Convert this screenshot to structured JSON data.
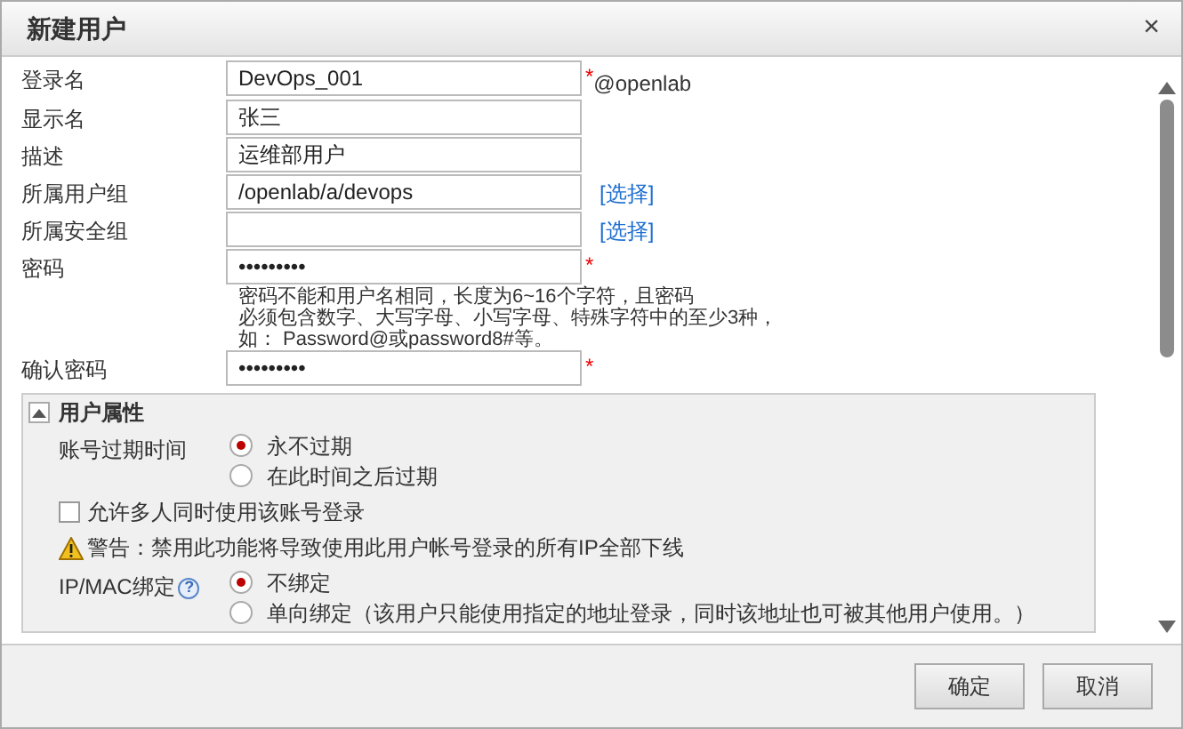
{
  "dialog": {
    "title": "新建用户",
    "close": "×"
  },
  "fields": [
    {
      "label": "登录名",
      "value": "DevOps_001",
      "marker": "*",
      "suffix": "@openlab"
    },
    {
      "label": "显示名",
      "value": "张三"
    },
    {
      "label": "描述",
      "value": "运维部用户"
    },
    {
      "label": "所属用户组",
      "value": "/openlab/a/devops",
      "link": "[选择]"
    },
    {
      "label": "所属安全组",
      "link": "[选择]"
    },
    {
      "label": "密码",
      "value": "•••••••••",
      "marker": "*",
      "hint": [
        "密码不能和用户名相同，长度为6~16个字符，且密码",
        "必须包含数字、大写字母、小写字母、特殊字符中的至少3种，",
        "如： Password@或password8#等。"
      ]
    },
    {
      "label": "确认密码",
      "value": "•••••••••",
      "marker": "*"
    }
  ],
  "section": {
    "title": "用户属性",
    "expanded": true,
    "expiry": {
      "label": "账号过期时间",
      "options": [
        {
          "label": "永不过期",
          "selected": true
        },
        {
          "label": "在此时间之后过期",
          "selected": false
        }
      ]
    },
    "multi_login": {
      "label": "允许多人同时使用该账号登录",
      "checked": false
    },
    "warning": "警告：禁用此功能将导致使用此用户帐号登录的所有IP全部下线",
    "binding": {
      "label": "IP/MAC绑定",
      "help": "?",
      "options": [
        {
          "label": "不绑定",
          "selected": true
        },
        {
          "label": "单向绑定（该用户只能使用指定的地址登录，同时该地址也可被其他用户使用。）",
          "selected": false
        }
      ]
    }
  },
  "buttons": [
    "确定",
    "取消"
  ]
}
